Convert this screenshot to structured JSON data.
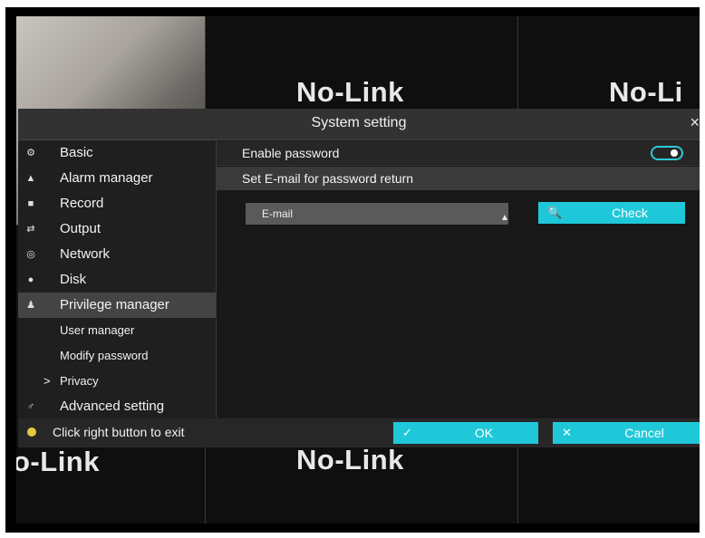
{
  "grid": {
    "no_link_text": "No-Link",
    "top_middle": "No-Link",
    "top_right": "No-Li",
    "bottom_left": "o-Link",
    "bottom_middle": "No-Link"
  },
  "dialog": {
    "title": "System setting",
    "close_glyph": "×"
  },
  "sidebar": {
    "items": [
      {
        "label": "Basic",
        "icon": "gear-icon",
        "glyph": "⚙"
      },
      {
        "label": "Alarm manager",
        "icon": "bell-icon",
        "glyph": "▲"
      },
      {
        "label": "Record",
        "icon": "video-camera-icon",
        "glyph": "■"
      },
      {
        "label": "Output",
        "icon": "output-icon",
        "glyph": "⇄"
      },
      {
        "label": "Network",
        "icon": "network-icon",
        "glyph": "◎"
      },
      {
        "label": "Disk",
        "icon": "disk-icon",
        "glyph": "●"
      },
      {
        "label": "Privilege manager",
        "icon": "user-icon",
        "glyph": "♟"
      }
    ],
    "subitems": [
      {
        "label": "User manager"
      },
      {
        "label": "Modify password"
      },
      {
        "label": "Privacy",
        "prefix": ">"
      }
    ],
    "advanced": {
      "label": "Advanced setting",
      "icon": "wrench-icon",
      "glyph": "♂"
    }
  },
  "main": {
    "enable_password_label": "Enable password",
    "set_email_label": "Set E-mail for password return",
    "email_placeholder": "E-mail",
    "check_label": "Check",
    "check_icon_glyph": "🔍"
  },
  "footer": {
    "hint": "Click right button to exit",
    "ok_label": "OK",
    "ok_glyph": "✓",
    "cancel_label": "Cancel",
    "cancel_glyph": "✕"
  },
  "colors": {
    "accent": "#1fc8d9",
    "active_item": "#444444"
  }
}
